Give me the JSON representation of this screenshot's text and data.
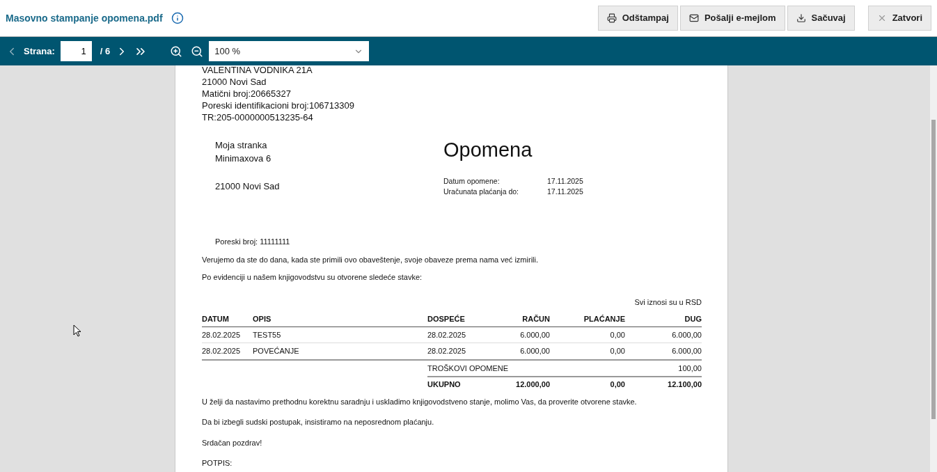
{
  "header": {
    "title": "Masovno stampanje opomena.pdf",
    "buttons": [
      {
        "kind": "print",
        "label": "Odštampaj"
      },
      {
        "kind": "email",
        "label": "Pošalji e-mejlom"
      },
      {
        "kind": "save",
        "label": "Sačuvaj"
      },
      {
        "kind": "close",
        "label": "Zatvori"
      }
    ]
  },
  "toolbar": {
    "page_label": "Strana:",
    "page_value": "1",
    "page_total": "/ 6",
    "zoom": "100 %"
  },
  "document": {
    "company_lines": [
      "VALENTINA VODNIKA 21A",
      "21000 Novi Sad",
      "Matični broj:20665327",
      "Poreski identifikacioni broj:106713309",
      "TR:205-0000000513235-64"
    ],
    "recipient_lines": [
      "Moja stranka",
      "Minimaxova 6",
      "21000 Novi Sad"
    ],
    "title": "Opomena",
    "meta": [
      {
        "label": "Datum opomene:",
        "value": "17.11.2025"
      },
      {
        "label": "Uračunata plaćanja do:",
        "value": "17.11.2025"
      }
    ],
    "tax_id": "Poreski broj: 11111111",
    "intro": [
      "Verujemo da ste do dana, kada ste primili ovo obaveštenje, svoje obaveze prema nama već izmirili.",
      "Po evidenciji u našem knjigovodstvu su otvorene sledeće stavke:"
    ],
    "currency_note": "Svi iznosi su u RSD",
    "table": {
      "columns": [
        "DATUM",
        "OPIS",
        "DOSPEĆE",
        "RAČUN",
        "PLAĆANJE",
        "DUG"
      ],
      "rows": [
        [
          "28.02.2025",
          "TEST55",
          "28.02.2025",
          "6.000,00",
          "0,00",
          "6.000,00"
        ],
        [
          "28.02.2025",
          "POVEĆANJE",
          "28.02.2025",
          "6.000,00",
          "0,00",
          "6.000,00"
        ]
      ],
      "fee": {
        "label": "TROŠKOVI OPOMENE",
        "dug": "100,00"
      },
      "total": {
        "label": "UKUPNO",
        "racun": "12.000,00",
        "placanje": "0,00",
        "dug": "12.100,00"
      }
    },
    "closing": [
      "U želji da nastavimo prethodnu korektnu saradnju i uskladimo knjigovodstveno stanje, molimo Vas, da proverite otvorene stavke.",
      "Da bi izbegli sudski postupak, insistiramo na neposrednom plaćanju.",
      "Srdačan pozdrav!"
    ],
    "signature": "POTPIS:"
  }
}
